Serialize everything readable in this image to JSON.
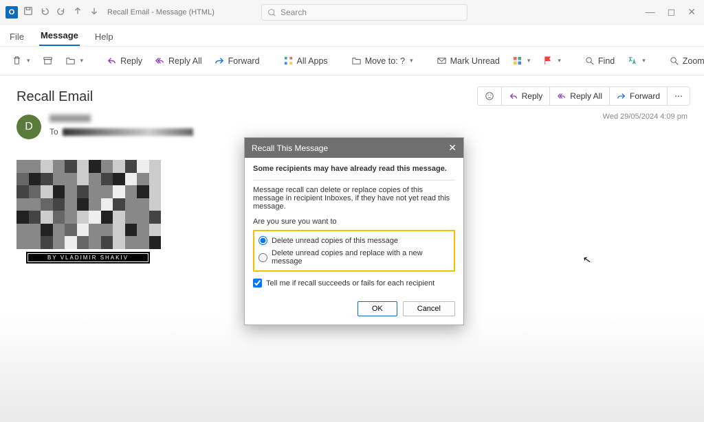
{
  "titlebar": {
    "app_letter": "O",
    "title": "Recall Email  -  Message (HTML)",
    "search_placeholder": "Search"
  },
  "menutabs": {
    "file": "File",
    "message": "Message",
    "help": "Help"
  },
  "ribbon": {
    "reply": "Reply",
    "reply_all": "Reply All",
    "forward": "Forward",
    "all_apps": "All Apps",
    "move_to": "Move to: ?",
    "mark_unread": "Mark Unread",
    "find": "Find",
    "zoom": "Zoom"
  },
  "message": {
    "subject": "Recall Email",
    "avatar_initial": "D",
    "to_label": "To",
    "timestamp": "Wed 29/05/2024 4:09 pm",
    "caption": "BY VLADIMIR SHAKIV"
  },
  "msg_actions": {
    "reply": "Reply",
    "reply_all": "Reply All",
    "forward": "Forward"
  },
  "dialog": {
    "title": "Recall This Message",
    "warning": "Some recipients may have already read this message.",
    "explain": "Message recall can delete or replace copies of this message in recipient Inboxes, if they have not yet read this message.",
    "question": "Are you sure you want to",
    "opt1": "Delete unread copies of this message",
    "opt2": "Delete unread copies and replace with a new message",
    "tell_me": "Tell me if recall succeeds or fails for each recipient",
    "ok": "OK",
    "cancel": "Cancel"
  }
}
